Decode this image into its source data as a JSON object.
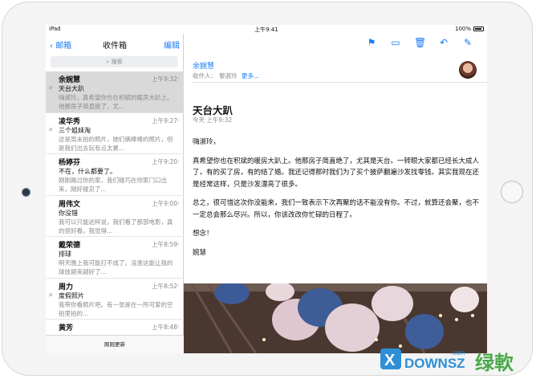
{
  "status": {
    "device": "iPad",
    "time": "上午9:41",
    "battery": "100%"
  },
  "sidebar": {
    "back_label": "邮箱",
    "title": "收件箱",
    "edit_label": "编辑",
    "search_placeholder": "搜索",
    "items": [
      {
        "name": "余婉慧",
        "time": "上午9:32",
        "subject": "天台大趴",
        "preview": "嗨淑玲，真希望你也在积斌的暖房大趴上。他那房子简直绝了，尤...",
        "attachment": true
      },
      {
        "name": "凌华秀",
        "time": "上午9:27",
        "subject": "三个姐妹淘",
        "preview": "这是周末拍的照片，她们俩棒棒的照片，但是我们出去玩有点太累...",
        "attachment": true
      },
      {
        "name": "杨婷芬",
        "time": "上午9:20",
        "subject": "不在，什么都要了。",
        "preview": "刚刚路过你的家，我们碰巧在你家门口出来，刚好碰见了...",
        "attachment": false
      },
      {
        "name": "周伟文",
        "time": "上午9:00",
        "subject": "你没错",
        "preview": "我可以只能这样说，我们看了那部电影，真的很好看，我觉得...",
        "attachment": false
      },
      {
        "name": "戴荣德",
        "time": "上午8:59",
        "subject": "排球",
        "preview": "明天晚上我可能打不成了。没准这能让我的球技越来越好了…",
        "attachment": false
      },
      {
        "name": "周力",
        "time": "上午8:52",
        "subject": "度假照片",
        "preview": "我带你看照片吧。有一张是在一所可爱的空拍里拍的…",
        "attachment": true
      },
      {
        "name": "黄芳",
        "time": "上午8:48",
        "subject": "",
        "preview": "",
        "attachment": false
      }
    ],
    "bottom_status": "刚刚更新"
  },
  "detail": {
    "from": "余婉慧",
    "to_label": "收件人：",
    "to_name": "黎淑玲",
    "more": "更多...",
    "subject": "天台大趴",
    "date": "今天 上午9:32",
    "body": [
      "嗨淑玲，",
      "真希望你也在积斌的暖房大趴上。他那房子简直绝了，尤其是天台。一转眼大家都已经长大成人了，有的买了房，有的结了婚。我还记得那时我们为了买个披萨翻遍沙发找零钱。其实我现在还是经常这样，只是沙发漂亮了很多。",
      "总之，很可惜这次你没能来，我们一致表示下次再聚的话不能没有你。不过，就算还会聚，也不一定总会那么尽兴。所以，你该改改你忙碌的日程了。",
      "想念！",
      "婉慧"
    ]
  },
  "watermark": {
    "brand": "DOWNSZ",
    "dot_com": ".com",
    "cn": "绿軟"
  },
  "colors": {
    "accent": "#1a7cf5",
    "selected_row": "#d9d9d9"
  }
}
